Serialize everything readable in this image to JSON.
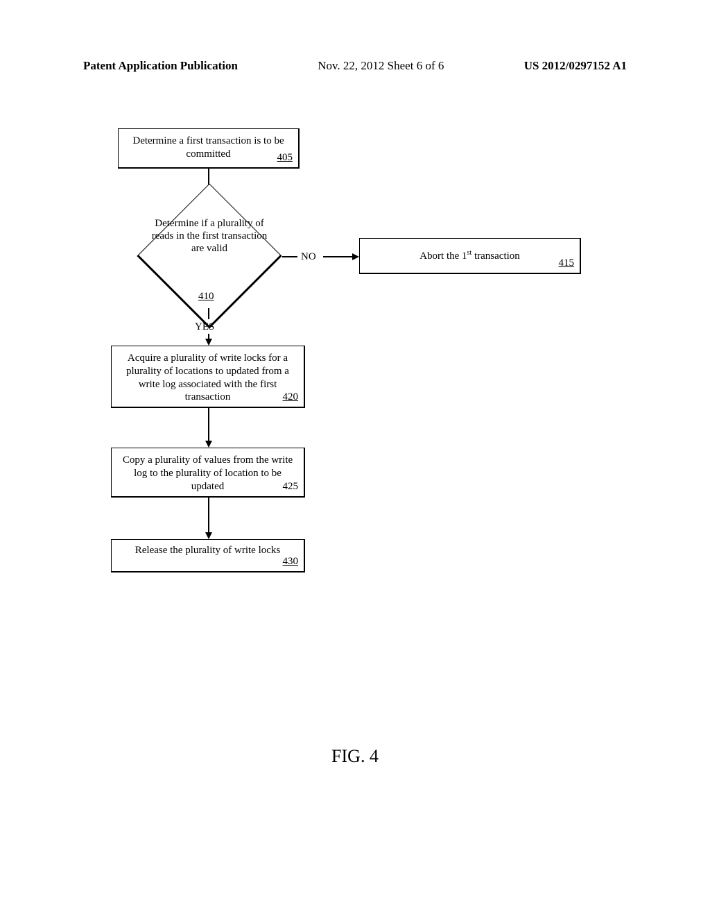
{
  "header": {
    "left": "Patent Application Publication",
    "center": "Nov. 22, 2012 Sheet 6 of 6",
    "right": "US 2012/0297152 A1"
  },
  "flowchart": {
    "box405": {
      "text": "Determine a first transaction is to be committed",
      "ref": "405"
    },
    "diamond410": {
      "text": "Determine if a plurality of reads in the first transaction are valid",
      "ref": "410"
    },
    "labels": {
      "no": "NO",
      "yes": "YES"
    },
    "box415": {
      "text_prefix": "Abort the 1",
      "text_sup": "st",
      "text_suffix": " transaction",
      "ref": "415"
    },
    "box420": {
      "text": "Acquire a plurality of write locks for a plurality of locations to updated from a write log associated with the first transaction",
      "ref": "420"
    },
    "box425": {
      "text": "Copy a plurality of values from the write log to the plurality of location to be updated",
      "ref": "425"
    },
    "box430": {
      "text": "Release the plurality of write locks",
      "ref": "430"
    }
  },
  "figure_label": "FIG. 4"
}
